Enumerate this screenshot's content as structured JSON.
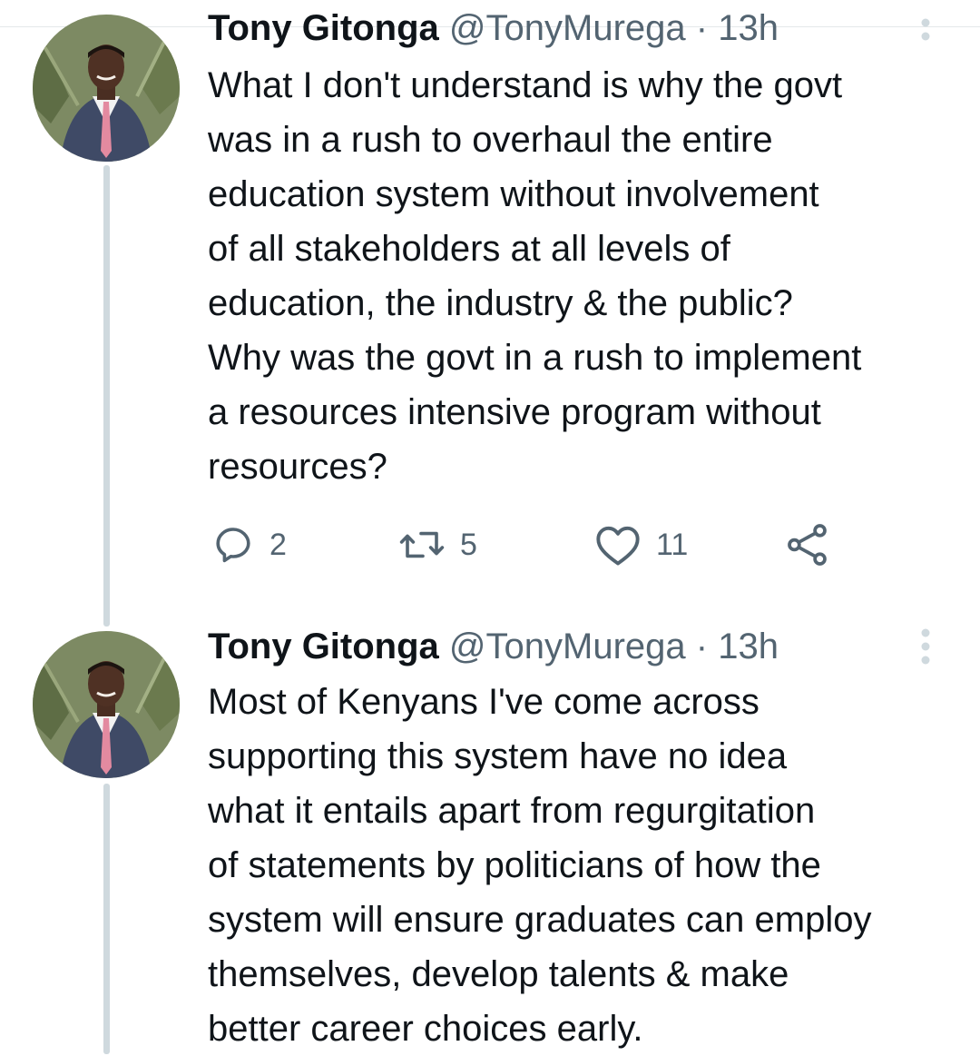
{
  "thread": [
    {
      "author_name": "Tony Gitonga",
      "author_handle": "@TonyMurega",
      "separator": "·",
      "time": "13h",
      "text": "What I don't understand is why the govt\nwas in a rush to overhaul the entire\neducation system without involvement\nof all stakeholders at all levels of\neducation, the industry & the public?\nWhy was the govt in a rush to implement\na resources intensive program without\nresources?",
      "replies": "2",
      "retweets": "5",
      "likes": "11"
    },
    {
      "author_name": "Tony Gitonga",
      "author_handle": "@TonyMurega",
      "separator": "·",
      "time": "13h",
      "text": "Most of Kenyans I've come across\nsupporting this system have no idea\nwhat it entails apart from regurgitation\nof statements by politicians of how the\nsystem will ensure graduates can employ\nthemselves, develop talents & make\nbetter career choices early."
    }
  ],
  "icons": {
    "reply": "reply-icon",
    "retweet": "retweet-icon",
    "like": "heart-icon",
    "share": "share-icon",
    "more": "more-vertical-icon"
  },
  "colors": {
    "text": "#0f1419",
    "secondary": "#536471",
    "thread_line": "#cfd9de"
  }
}
